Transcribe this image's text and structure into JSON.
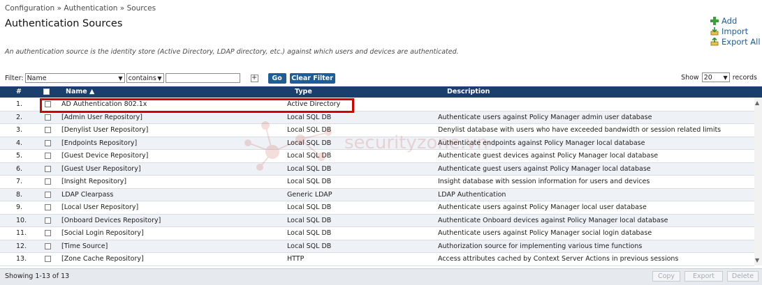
{
  "breadcrumb": {
    "items": [
      "Configuration",
      "Authentication",
      "Sources"
    ],
    "separator": "»"
  },
  "page_title": "Authentication Sources",
  "description": "An authentication source is the identity store (Active Directory, LDAP directory, etc.) against which users and devices are authenticated.",
  "actions": {
    "add": "Add",
    "import": "Import",
    "export_all": "Export All"
  },
  "filter": {
    "label": "Filter:",
    "field": "Name",
    "operator": "contains",
    "value": "",
    "go_label": "Go",
    "clear_label": "Clear Filter"
  },
  "show": {
    "label": "Show",
    "value": "20",
    "suffix": "records"
  },
  "table": {
    "headers": {
      "num": "#",
      "name": "Name ▲",
      "type": "Type",
      "description": "Description"
    },
    "rows": [
      {
        "num": "1.",
        "name": "AD Authentication 802.1x",
        "type": "Active Directory",
        "description": ""
      },
      {
        "num": "2.",
        "name": "[Admin User Repository]",
        "type": "Local SQL DB",
        "description": "Authenticate users against Policy Manager admin user database"
      },
      {
        "num": "3.",
        "name": "[Denylist User Repository]",
        "type": "Local SQL DB",
        "description": "Denylist database with users who have exceeded bandwidth or session related limits"
      },
      {
        "num": "4.",
        "name": "[Endpoints Repository]",
        "type": "Local SQL DB",
        "description": "Authenticate endpoints against Policy Manager local database"
      },
      {
        "num": "5.",
        "name": "[Guest Device Repository]",
        "type": "Local SQL DB",
        "description": "Authenticate guest devices against Policy Manager local database"
      },
      {
        "num": "6.",
        "name": "[Guest User Repository]",
        "type": "Local SQL DB",
        "description": "Authenticate guest users against Policy Manager local database"
      },
      {
        "num": "7.",
        "name": "[Insight Repository]",
        "type": "Local SQL DB",
        "description": "Insight database with session information for users and devices"
      },
      {
        "num": "8.",
        "name": "LDAP Clearpass",
        "type": "Generic LDAP",
        "description": "LDAP Authentication"
      },
      {
        "num": "9.",
        "name": "[Local User Repository]",
        "type": "Local SQL DB",
        "description": "Authenticate users against Policy Manager local user database"
      },
      {
        "num": "10.",
        "name": "[Onboard Devices Repository]",
        "type": "Local SQL DB",
        "description": "Authenticate Onboard devices against Policy Manager local database"
      },
      {
        "num": "11.",
        "name": "[Social Login Repository]",
        "type": "Local SQL DB",
        "description": "Authenticate users against Policy Manager social login database"
      },
      {
        "num": "12.",
        "name": "[Time Source]",
        "type": "Local SQL DB",
        "description": "Authorization source for implementing various time functions"
      },
      {
        "num": "13.",
        "name": "[Zone Cache Repository]",
        "type": "HTTP",
        "description": "Access attributes cached by Context Server Actions in previous sessions"
      }
    ]
  },
  "footer": {
    "status": "Showing 1-13 of 13",
    "copy": "Copy",
    "export": "Export",
    "delete": "Delete"
  },
  "watermark": "securityzone.vn",
  "colors": {
    "header_bg": "#1b3f6c",
    "button_bg": "#1f5d99",
    "link": "#1a5ea8",
    "highlight": "#d40000"
  }
}
